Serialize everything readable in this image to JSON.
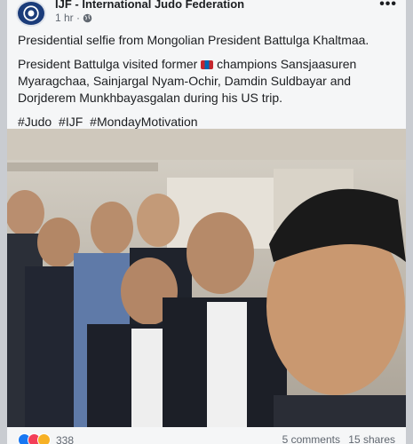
{
  "post": {
    "page_name": "IJF - International Judo Federation",
    "time": "1 hr ·",
    "headline": "Presidential selfie from Mongolian President Battulga Khaltmaa.",
    "body_before_flag": "President Battulga visited former",
    "body_after_flag": "champions Sansjaasuren Myaragchaa, Sainjargal Nyam-Ochir, Damdin Suldbayar and Dorjderem Munkhbayasgalan during his US trip.",
    "hashtags": [
      "#Judo",
      "#IJF",
      "#MondayMotivation"
    ]
  },
  "icons": {
    "avatar": "ijf-logo",
    "privacy": "globe-icon",
    "flag": "mongolia-flag-icon",
    "more": "more-options-icon",
    "reactions": [
      "like-icon",
      "love-icon",
      "haha-icon"
    ]
  },
  "footer": {
    "reaction_count": "338",
    "comments": "5 comments",
    "shares": "15 shares"
  },
  "colors": {
    "brand": "#1b3c7a",
    "flag_red": "#c4272f",
    "flag_blue": "#0066b3"
  }
}
